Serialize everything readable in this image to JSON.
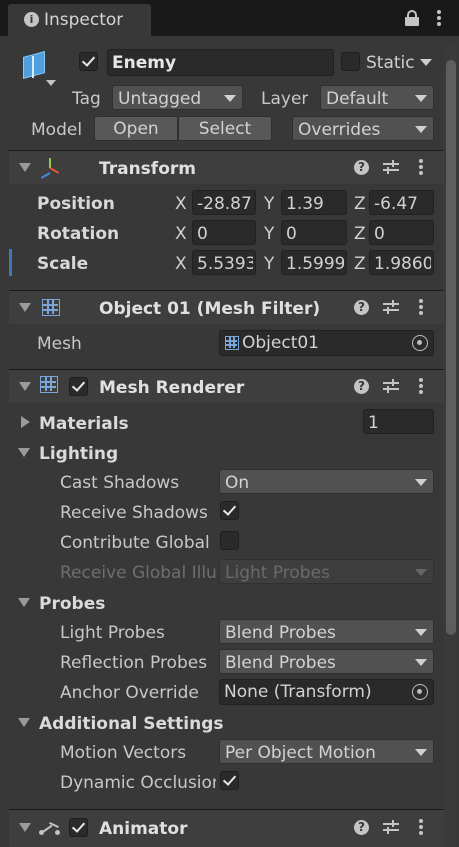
{
  "window": {
    "tab_title": "Inspector",
    "colors": {
      "background": "#383838",
      "header": "#3e3e3e",
      "field": "#2a2a2a",
      "dropdown": "#515151",
      "accent_blue": "#3a79bb"
    }
  },
  "object": {
    "active": true,
    "name": "Enemy",
    "static_label": "Static",
    "static_checked": false,
    "tag_label": "Tag",
    "tag_value": "Untagged",
    "layer_label": "Layer",
    "layer_value": "Default",
    "model_label": "Model",
    "open_label": "Open",
    "select_label": "Select",
    "overrides_label": "Overrides"
  },
  "transform": {
    "title": "Transform",
    "rows": [
      {
        "label": "Position",
        "x": "-28.87",
        "y": "1.39",
        "z": "-6.47"
      },
      {
        "label": "Rotation",
        "x": "0",
        "y": "0",
        "z": "0"
      },
      {
        "label": "Scale",
        "x": "5.5393",
        "y": "1.5999",
        "z": "1.9860"
      }
    ],
    "axis_x": "X",
    "axis_y": "Y",
    "axis_z": "Z"
  },
  "mesh_filter": {
    "title": "Object 01 (Mesh Filter)",
    "mesh_label": "Mesh",
    "mesh_value": "Object01"
  },
  "mesh_renderer": {
    "title": "Mesh Renderer",
    "enabled": true,
    "materials_label": "Materials",
    "materials_count": "1",
    "lighting_label": "Lighting",
    "cast_shadows_label": "Cast Shadows",
    "cast_shadows_value": "On",
    "receive_shadows_label": "Receive Shadows",
    "receive_shadows_checked": true,
    "contribute_gi_label": "Contribute Global",
    "contribute_gi_checked": false,
    "receive_gi_label": "Receive Global Illumination",
    "receive_gi_value": "Light Probes",
    "probes_label": "Probes",
    "light_probes_label": "Light Probes",
    "light_probes_value": "Blend Probes",
    "reflection_probes_label": "Reflection Probes",
    "reflection_probes_value": "Blend Probes",
    "anchor_override_label": "Anchor Override",
    "anchor_override_value": "None (Transform)",
    "additional_label": "Additional Settings",
    "motion_vectors_label": "Motion Vectors",
    "motion_vectors_value": "Per Object Motion",
    "dynamic_occlusion_label": "Dynamic Occlusion",
    "dynamic_occlusion_checked": true
  },
  "animator": {
    "title": "Animator",
    "enabled": true
  },
  "icons": {
    "help": "?",
    "info": "i"
  }
}
